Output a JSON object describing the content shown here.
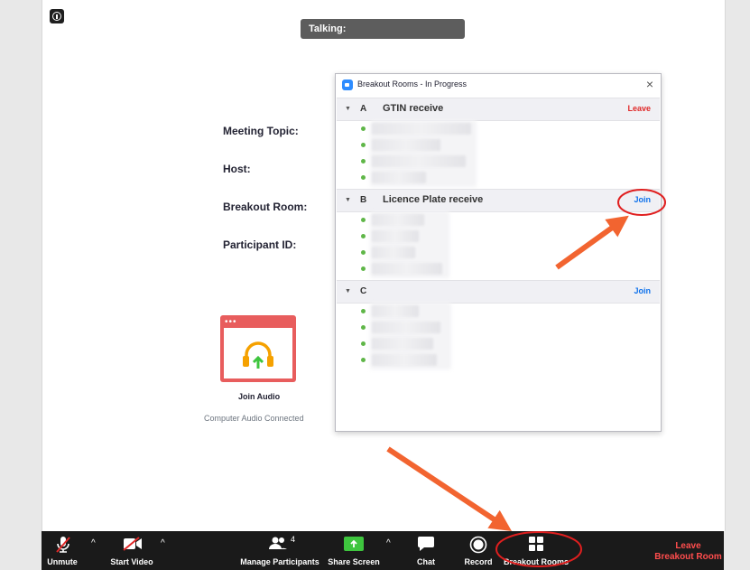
{
  "talking_bar": {
    "label": "Talking:"
  },
  "meeting_info": {
    "topic_label": "Meeting Topic:",
    "host_label": "Host:",
    "breakout_room_label": "Breakout Room:",
    "participant_id_label": "Participant ID:"
  },
  "audio": {
    "join_label": "Join Audio",
    "status": "Computer Audio Connected"
  },
  "dialog": {
    "title": "Breakout Rooms - In Progress",
    "close_glyph": "×",
    "rooms": [
      {
        "letter": "A",
        "name": "GTIN receive",
        "action": "Leave"
      },
      {
        "letter": "B",
        "name": "Licence Plate receive",
        "action": "Join"
      },
      {
        "letter": "C",
        "name": "",
        "action": "Join"
      }
    ]
  },
  "toolbar": {
    "unmute": "Unmute",
    "start_video": "Start Video",
    "manage_participants": "Manage Participants",
    "participant_count": "4",
    "share_screen": "Share Screen",
    "chat": "Chat",
    "record": "Record",
    "breakout_rooms": "Breakout Rooms",
    "leave_line1": "Leave",
    "leave_line2": "Breakout Room",
    "caret_glyph": "^"
  },
  "colors": {
    "annotation_orange": "#f26430",
    "annotation_red": "#e01f1f",
    "leave_red": "#e02828",
    "join_blue": "#0e71eb",
    "share_green": "#3ec53e"
  }
}
